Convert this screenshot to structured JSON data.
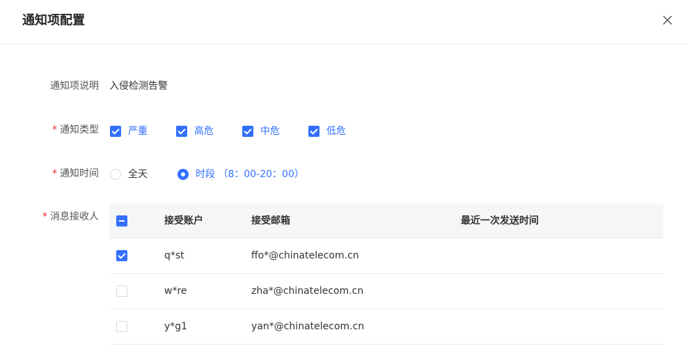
{
  "dialog": {
    "title": "通知项配置"
  },
  "form": {
    "description": {
      "label": "通知项说明",
      "value": "入侵检测告警"
    },
    "type": {
      "label": "通知类型",
      "options": [
        {
          "label": "严重",
          "checked": true
        },
        {
          "label": "高危",
          "checked": true
        },
        {
          "label": "中危",
          "checked": true
        },
        {
          "label": "低危",
          "checked": true
        }
      ]
    },
    "time": {
      "label": "通知时间",
      "options": [
        {
          "label": "全天",
          "selected": false
        },
        {
          "label": "时段 （8：00-20：00）",
          "selected": true
        }
      ]
    },
    "recipients": {
      "label": "消息接收人",
      "columns": [
        "接受账户",
        "接受邮箱",
        "最近一次发送时间"
      ],
      "rows": [
        {
          "account": "q*st",
          "email": "ffo*@chinatelecom.cn",
          "last_sent": "",
          "checked": true
        },
        {
          "account": "w*re",
          "email": "zha*@chinatelecom.cn",
          "last_sent": "",
          "checked": false
        },
        {
          "account": "y*g1",
          "email": "yan*@chinatelecom.cn",
          "last_sent": "",
          "checked": false
        }
      ]
    }
  },
  "required_mark": "*",
  "colors": {
    "accent": "#3370ff",
    "required": "#f5222d"
  }
}
